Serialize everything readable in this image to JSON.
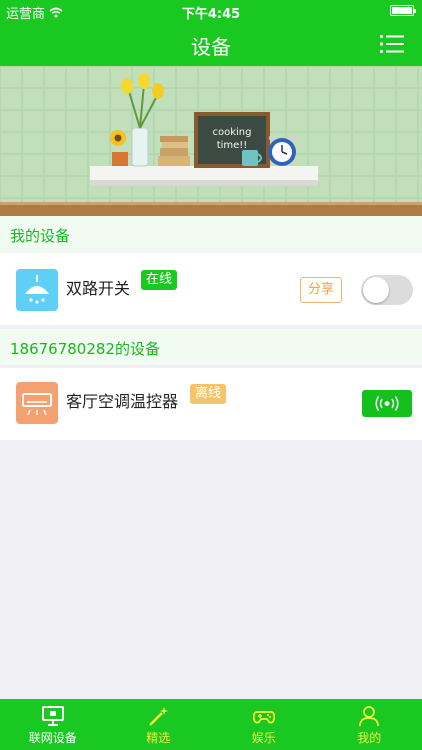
{
  "status_bar": {
    "carrier": "运营商",
    "time": "下午4:45"
  },
  "nav": {
    "title": "设备"
  },
  "banner": {
    "chalkboard_line1": "cooking",
    "chalkboard_line2": "time!!"
  },
  "sections": [
    {
      "title": "我的设备"
    },
    {
      "title": "18676780282的设备"
    }
  ],
  "devices": [
    {
      "name": "双路开关",
      "status": "在线",
      "status_color": "#19c922",
      "share_label": "分享",
      "icon": "ceiling-lamp-icon",
      "icon_bg": "#5ed0f5",
      "switch_on": false
    },
    {
      "name": "客厅空调温控器",
      "status": "离线",
      "status_color": "#f5c46a",
      "icon": "air-conditioner-icon",
      "icon_bg": "#f4a071",
      "action_icon": "remote-signal-icon"
    }
  ],
  "tabs": [
    {
      "label": "联网设备",
      "icon": "monitor-icon",
      "active": true
    },
    {
      "label": "精选",
      "icon": "magic-wand-icon",
      "active": false
    },
    {
      "label": "娱乐",
      "icon": "gamepad-icon",
      "active": false
    },
    {
      "label": "我的",
      "icon": "person-icon",
      "active": false
    }
  ],
  "colors": {
    "primary": "#19c922",
    "section_text": "#19b81f",
    "inactive_tab": "#f4ee3a",
    "active_tab": "#ffffff"
  }
}
